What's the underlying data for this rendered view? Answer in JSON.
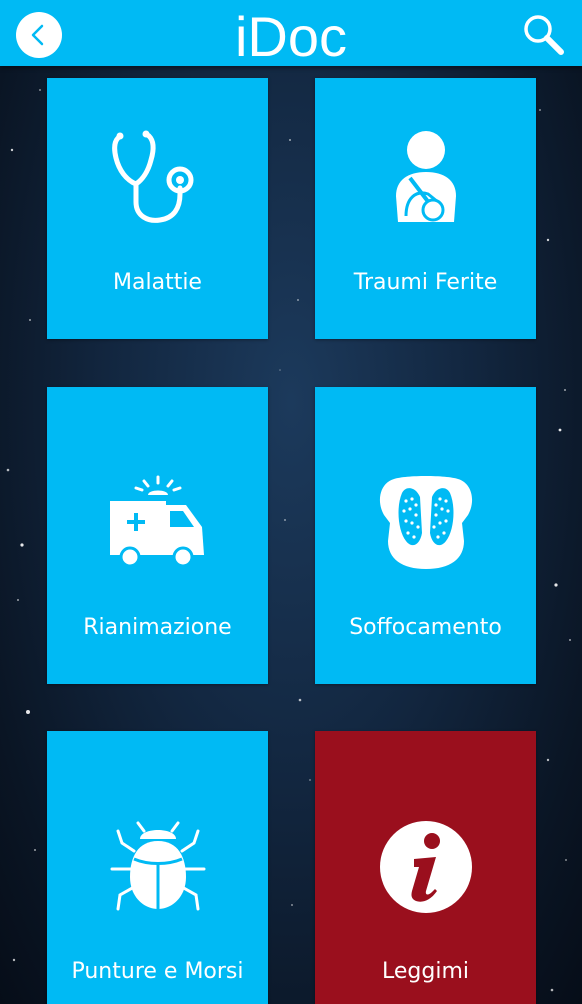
{
  "header": {
    "title": "iDoc",
    "back_icon": "chevron-left-icon",
    "search_icon": "magnifier-icon",
    "bar_color": "#00baf4"
  },
  "menu": {
    "tiles": [
      {
        "label": "Malattie",
        "icon": "stethoscope-icon",
        "color": "#00baf4"
      },
      {
        "label": "Traumi Ferite",
        "icon": "arm-sling-icon",
        "color": "#00baf4"
      },
      {
        "label": "Rianimazione",
        "icon": "ambulance-icon",
        "color": "#00baf4"
      },
      {
        "label": "Soffocamento",
        "icon": "lungs-icon",
        "color": "#00baf4"
      },
      {
        "label": "Punture e Morsi",
        "icon": "bug-icon",
        "color": "#00baf4"
      },
      {
        "label": "Leggimi",
        "icon": "info-icon",
        "color": "#9a0f1d"
      }
    ]
  }
}
